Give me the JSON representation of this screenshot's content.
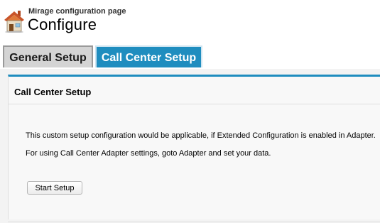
{
  "header": {
    "subtitle": "Mirage configuration page",
    "title": "Configure",
    "icon": "house-icon"
  },
  "tabs": [
    {
      "label": "General Setup",
      "active": false
    },
    {
      "label": "Call Center Setup",
      "active": true
    }
  ],
  "panel": {
    "title": "Call Center Setup",
    "line1": "This custom setup configuration would be applicable, if Extended Configuration is enabled in Adapter.",
    "line2": "For using Call Center Adapter settings, goto Adapter and set your data.",
    "start_button": "Start Setup"
  },
  "colors": {
    "accent": "#1f8dbf",
    "inactive_tab": "#d4d4d4",
    "panel_bg": "#f8f8f8"
  }
}
